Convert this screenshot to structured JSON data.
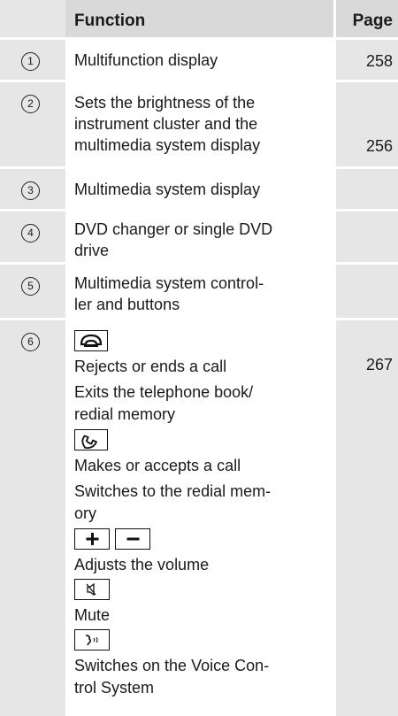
{
  "header": {
    "function": "Function",
    "page": "Page"
  },
  "rows": [
    {
      "num": "1",
      "text_lines": [
        "Multifunction display"
      ],
      "page": "258"
    },
    {
      "num": "2",
      "text_lines": [
        "Sets the brightness of the",
        "instrument cluster and the",
        "multimedia system display"
      ],
      "page": "256"
    },
    {
      "num": "3",
      "text_lines": [
        "Multimedia system display"
      ],
      "page": ""
    },
    {
      "num": "4",
      "text_lines": [
        "DVD changer or single DVD",
        "drive"
      ],
      "page": ""
    },
    {
      "num": "5",
      "text_lines": [
        "Multimedia system control-",
        "ler and buttons"
      ],
      "page": ""
    }
  ],
  "row6": {
    "num": "6",
    "page": "267",
    "reject_1": "Rejects or ends a call",
    "exit_1": "Exits the telephone book/",
    "exit_2": "redial memory",
    "accept_1": "Makes or accepts a call",
    "switch_1": "Switches to the redial mem-",
    "switch_2": "ory",
    "volume_1": "Adjusts the volume",
    "mute_1": "Mute",
    "voice_1": "Switches on the Voice Con-",
    "voice_2": "trol System"
  }
}
